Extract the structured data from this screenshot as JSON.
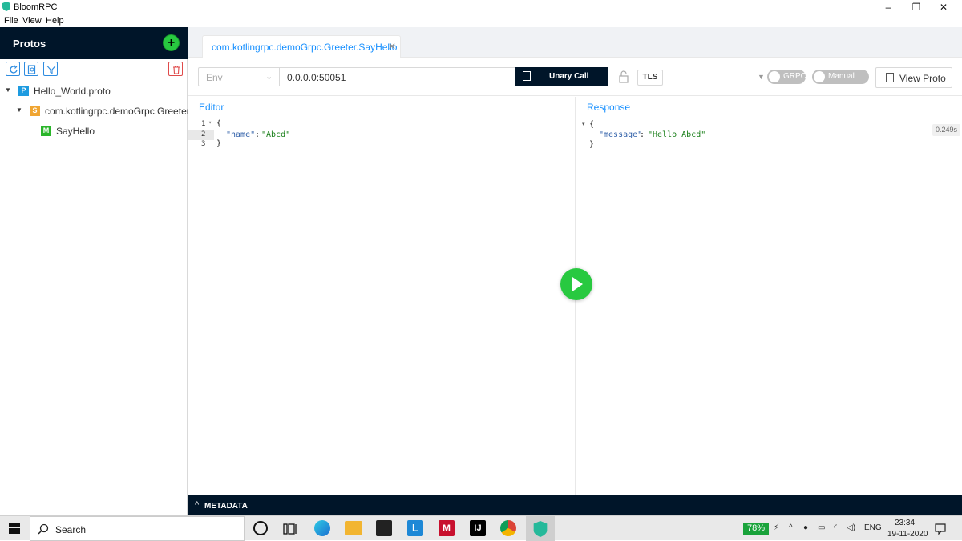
{
  "window": {
    "title": "BloomRPC"
  },
  "menu": [
    "File",
    "View",
    "Help"
  ],
  "sidebar": {
    "title": "Protos",
    "tree": [
      {
        "badge": "P",
        "label": "Hello_World.proto",
        "badge_color": "#1e9be0"
      },
      {
        "badge": "S",
        "label": "com.kotlingrpc.demoGrpc.Greeter",
        "badge_color": "#f0a532"
      },
      {
        "badge": "M",
        "label": "SayHello",
        "badge_color": "#2ab52a"
      }
    ]
  },
  "tabs": [
    {
      "label": "com.kotlingrpc.demoGrpc.Greeter.SayHello"
    }
  ],
  "request": {
    "env_placeholder": "Env",
    "url": "0.0.0.0:50051",
    "call_button": "Unary Call",
    "tls_label": "TLS",
    "grpc_toggle": "GRPC",
    "manual_toggle": "Manual",
    "view_proto": "View Proto"
  },
  "editor": {
    "title": "Editor",
    "lines": [
      {
        "num": "1",
        "text": "{"
      },
      {
        "num": "2",
        "key": "\"name\"",
        "sep": ": ",
        "value": "\"Abcd\""
      },
      {
        "num": "3",
        "text": "}"
      }
    ]
  },
  "response": {
    "title": "Response",
    "timing": "0.249s",
    "lines": [
      {
        "text": "{"
      },
      {
        "key": "\"message\"",
        "sep": ": ",
        "value": "\"Hello Abcd\""
      },
      {
        "text": "}"
      }
    ]
  },
  "metadata": {
    "label": "METADATA"
  },
  "taskbar": {
    "search_label": "Search",
    "battery": "78%",
    "language": "ENG",
    "time": "23:34",
    "date": "19-11-2020"
  },
  "colors": {
    "accent": "#1890ff",
    "dark": "#001529",
    "play": "#28c940"
  }
}
